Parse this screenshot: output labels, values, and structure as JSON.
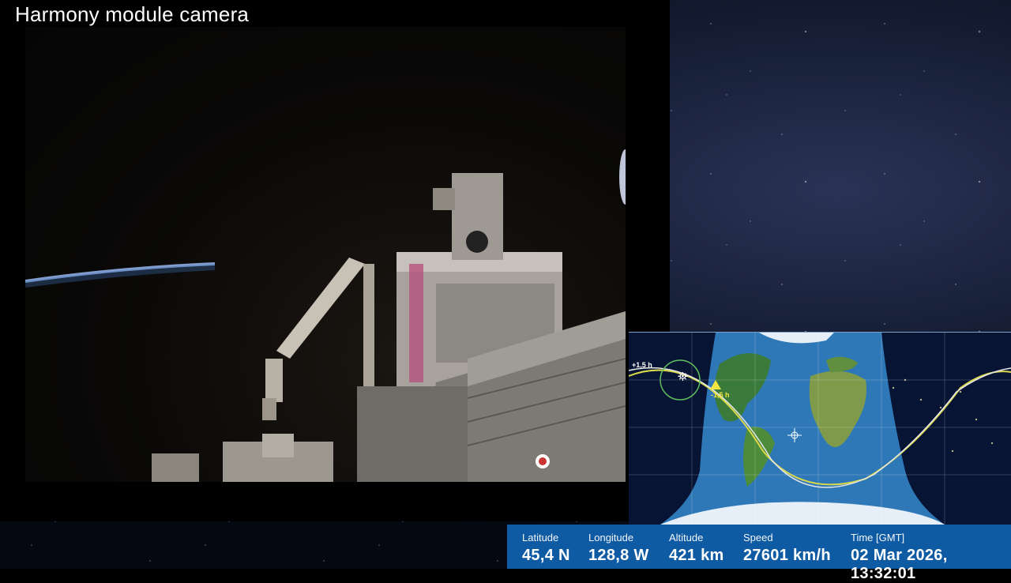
{
  "video": {
    "title": "Harmony module camera"
  },
  "map": {
    "orbit_marker_plus": "+1,5 h",
    "orbit_marker_minus": "-1,5 h",
    "day_color": "#2f78b7",
    "night_color": "#071433"
  },
  "telemetry": {
    "latitude_label": "Latitude",
    "latitude_value": "45,4 N",
    "longitude_label": "Longitude",
    "longitude_value": "128,8 W",
    "altitude_label": "Altitude",
    "altitude_value": "421 km",
    "speed_label": "Speed",
    "speed_value": "27601 km/h",
    "time_label": "Time [GMT]",
    "time_value": "02 Mar 2026, 13:32:01"
  },
  "colors": {
    "telemetry_bar": "#0e5aa3"
  }
}
